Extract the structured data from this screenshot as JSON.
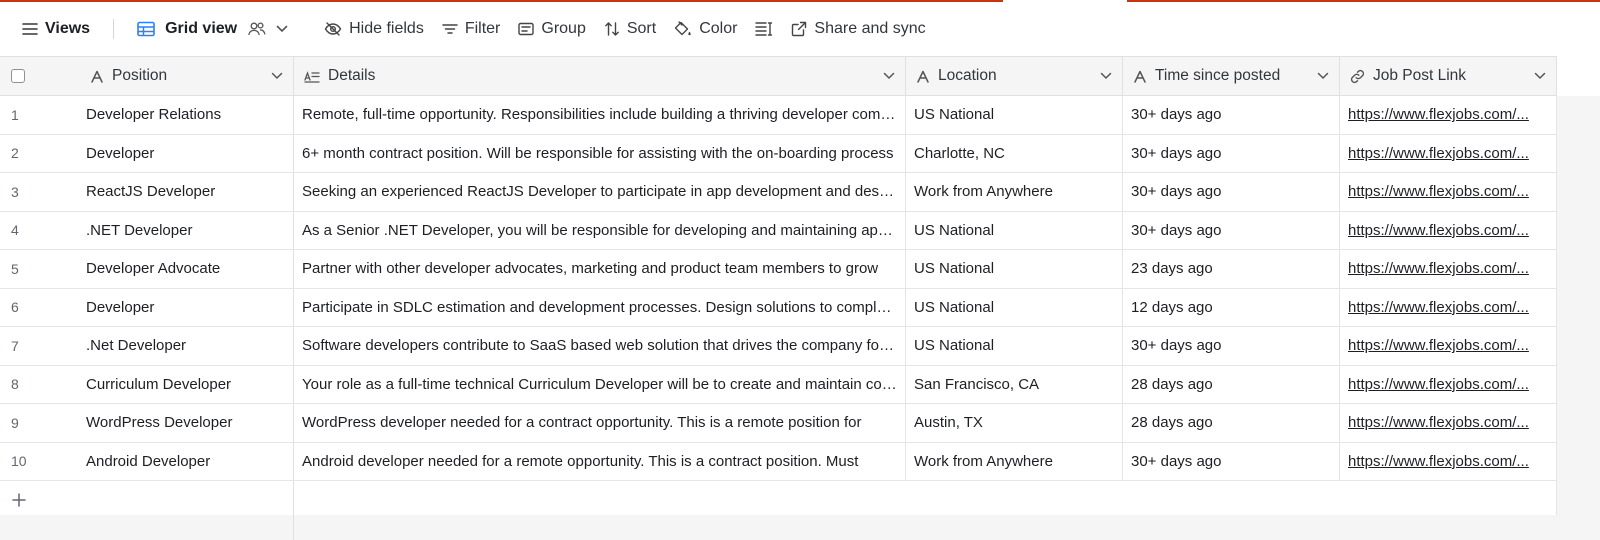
{
  "toolbar": {
    "views_label": "Views",
    "grid_view_label": "Grid view",
    "hide_fields_label": "Hide fields",
    "filter_label": "Filter",
    "group_label": "Group",
    "sort_label": "Sort",
    "color_label": "Color",
    "share_label": "Share and sync"
  },
  "columns": {
    "position": "Position",
    "details": "Details",
    "location": "Location",
    "time": "Time since posted",
    "link": "Job Post Link"
  },
  "rows": [
    {
      "num": "1",
      "position": "Developer Relations",
      "details": "Remote, full-time opportunity. Responsibilities include building a thriving developer community",
      "location": "US National",
      "time": "30+ days ago",
      "link": "https://www.flexjobs.com/..."
    },
    {
      "num": "2",
      "position": "Developer",
      "details": "6+ month contract position. Will be responsible for assisting with the on-boarding process",
      "location": "Charlotte, NC",
      "time": "30+ days ago",
      "link": "https://www.flexjobs.com/..."
    },
    {
      "num": "3",
      "position": "ReactJS Developer",
      "details": "Seeking an experienced ReactJS Developer to participate in app development and design",
      "location": "Work from Anywhere",
      "time": "30+ days ago",
      "link": "https://www.flexjobs.com/..."
    },
    {
      "num": "4",
      "position": ".NET Developer",
      "details": "As a Senior .NET Developer, you will be responsible for developing and maintaining applications",
      "location": "US National",
      "time": "30+ days ago",
      "link": "https://www.flexjobs.com/..."
    },
    {
      "num": "5",
      "position": "Developer Advocate",
      "details": "Partner with other developer advocates, marketing and product team members to grow",
      "location": "US National",
      "time": "23 days ago",
      "link": "https://www.flexjobs.com/..."
    },
    {
      "num": "6",
      "position": "Developer",
      "details": "Participate in SDLC estimation and development processes. Design solutions to complex problems",
      "location": "US National",
      "time": "12 days ago",
      "link": "https://www.flexjobs.com/..."
    },
    {
      "num": "7",
      "position": ".Net Developer",
      "details": "Software developers contribute to SaaS based web solution that drives the company forward",
      "location": "US National",
      "time": "30+ days ago",
      "link": "https://www.flexjobs.com/..."
    },
    {
      "num": "8",
      "position": "Curriculum Developer",
      "details": "Your role as a full-time technical Curriculum Developer will be to create and maintain content",
      "location": "San Francisco, CA",
      "time": "28 days ago",
      "link": "https://www.flexjobs.com/..."
    },
    {
      "num": "9",
      "position": "WordPress Developer",
      "details": "WordPress developer needed for a contract opportunity. This is a remote position for",
      "location": "Austin, TX",
      "time": "28 days ago",
      "link": "https://www.flexjobs.com/..."
    },
    {
      "num": "10",
      "position": "Android Developer",
      "details": "Android developer needed for a remote opportunity. This is a contract position. Must",
      "location": "Work from Anywhere",
      "time": "30+ days ago",
      "link": "https://www.flexjobs.com/..."
    }
  ],
  "colors": {
    "accent": "#c8350f",
    "grid_icon": "#2d7ff9",
    "header_bg": "#f5f5f5",
    "border": "#dfe0e2"
  },
  "icons": {
    "views": "hamburger-icon",
    "grid": "grid-icon",
    "collaborators": "people-icon",
    "hide_fields": "eye-slash-icon",
    "filter": "filter-icon",
    "group": "group-icon",
    "sort": "sort-icon",
    "color": "paint-bucket-icon",
    "row_height": "row-height-icon",
    "share": "external-link-icon",
    "add": "plus-icon"
  }
}
